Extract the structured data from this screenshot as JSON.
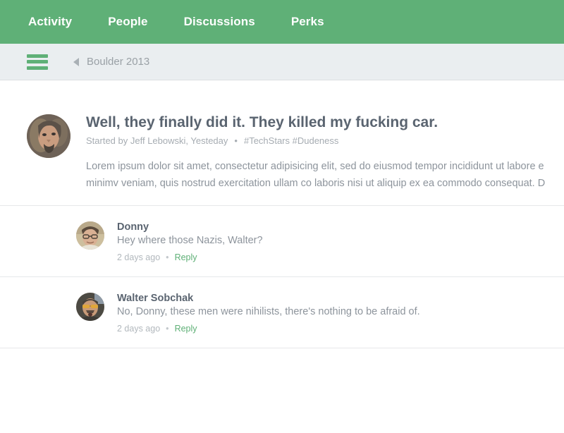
{
  "theme": {
    "brand_green": "#5fb077",
    "subnav_bg": "#eaeef0",
    "heading_color": "#5a6470",
    "muted_color": "#8d949c"
  },
  "topnav": {
    "items": [
      {
        "label": "Activity"
      },
      {
        "label": "People"
      },
      {
        "label": "Discussions"
      },
      {
        "label": "Perks"
      }
    ]
  },
  "subnav": {
    "menu_icon": "hamburger-icon",
    "back_icon": "back-arrow-icon",
    "breadcrumb_label": "Boulder 2013"
  },
  "post": {
    "avatar_icon": "avatar-jeff-lebowski",
    "title": "Well, they finally did it. They killed my fucking car.",
    "meta": {
      "started_by": "Started by Jeff Lebowski, Yesteday",
      "separator": "•",
      "tags": "#TechStars #Dudeness"
    },
    "body_lines": [
      "Lorem ipsum dolor sit amet, consectetur adipisicing elit, sed do eiusmod tempor incididunt ut labore e",
      "minimv veniam, quis nostrud exercitation ullam co laboris nisi ut aliquip ex ea commodo consequat. D"
    ]
  },
  "comments": [
    {
      "avatar_icon": "avatar-donny",
      "author": "Donny",
      "text": "Hey where those Nazis, Walter?",
      "timestamp": "2 days ago",
      "separator": "•",
      "reply_label": "Reply"
    },
    {
      "avatar_icon": "avatar-walter-sobchak",
      "author": "Walter Sobchak",
      "text": "No, Donny, these men were nihilists, there's nothing to be afraid of.",
      "timestamp": "2 days ago",
      "separator": "•",
      "reply_label": "Reply"
    }
  ]
}
